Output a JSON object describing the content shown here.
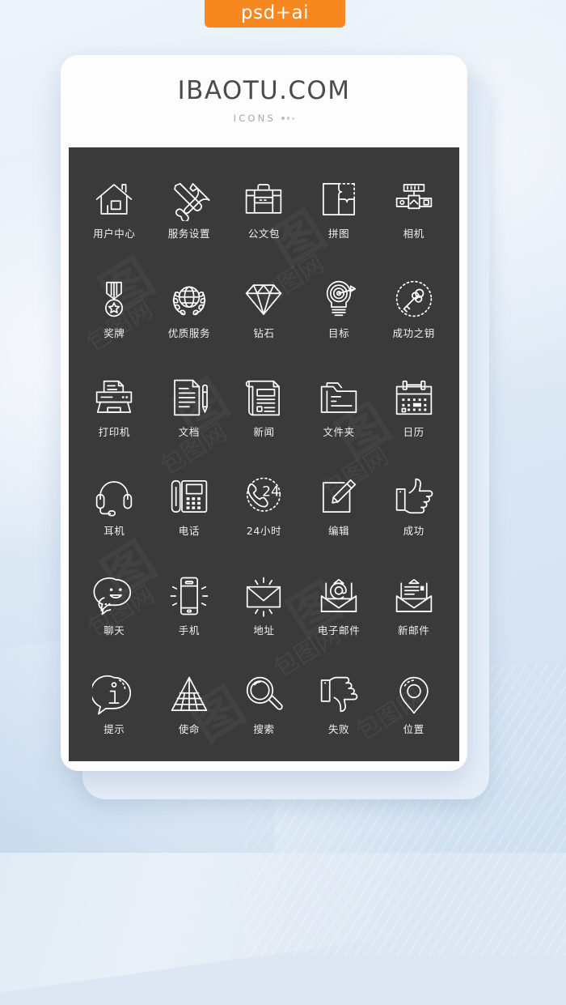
{
  "badge": {
    "label": "psd+ai",
    "color": "#f6881f"
  },
  "card": {
    "title": "IBAOTU.COM",
    "subtitle": "ICONS",
    "panel_color": "#3a3a3a",
    "card_color": "#fdfdfd"
  },
  "watermark": {
    "text": "包图网",
    "mark": "图"
  },
  "icons": [
    {
      "label": "用户中心",
      "name": "home-icon"
    },
    {
      "label": "服务设置",
      "name": "tools-icon"
    },
    {
      "label": "公文包",
      "name": "briefcase-icon"
    },
    {
      "label": "拼图",
      "name": "puzzle-icon"
    },
    {
      "label": "相机",
      "name": "camera-icon"
    },
    {
      "label": "奖牌",
      "name": "medal-icon"
    },
    {
      "label": "优质服务",
      "name": "globe-laurel-icon"
    },
    {
      "label": "钻石",
      "name": "diamond-icon"
    },
    {
      "label": "目标",
      "name": "target-bulb-icon"
    },
    {
      "label": "成功之钥",
      "name": "key-icon"
    },
    {
      "label": "打印机",
      "name": "printer-icon"
    },
    {
      "label": "文档",
      "name": "document-pen-icon"
    },
    {
      "label": "新闻",
      "name": "newspaper-icon"
    },
    {
      "label": "文件夹",
      "name": "folder-icon"
    },
    {
      "label": "日历",
      "name": "calendar-icon"
    },
    {
      "label": "耳机",
      "name": "headset-icon"
    },
    {
      "label": "电话",
      "name": "telephone-icon"
    },
    {
      "label": "24小时",
      "name": "phone-24h-icon"
    },
    {
      "label": "编辑",
      "name": "edit-icon"
    },
    {
      "label": "成功",
      "name": "thumbs-up-icon"
    },
    {
      "label": "聊天",
      "name": "chat-icon"
    },
    {
      "label": "手机",
      "name": "mobile-icon"
    },
    {
      "label": "地址",
      "name": "envelope-icon"
    },
    {
      "label": "电子邮件",
      "name": "email-at-icon"
    },
    {
      "label": "新邮件",
      "name": "new-mail-icon"
    },
    {
      "label": "提示",
      "name": "info-bubble-icon"
    },
    {
      "label": "使命",
      "name": "pyramid-icon"
    },
    {
      "label": "搜索",
      "name": "magnifier-icon"
    },
    {
      "label": "失败",
      "name": "thumbs-down-icon"
    },
    {
      "label": "位置",
      "name": "location-pin-icon"
    }
  ],
  "phone_24h_text": "24"
}
